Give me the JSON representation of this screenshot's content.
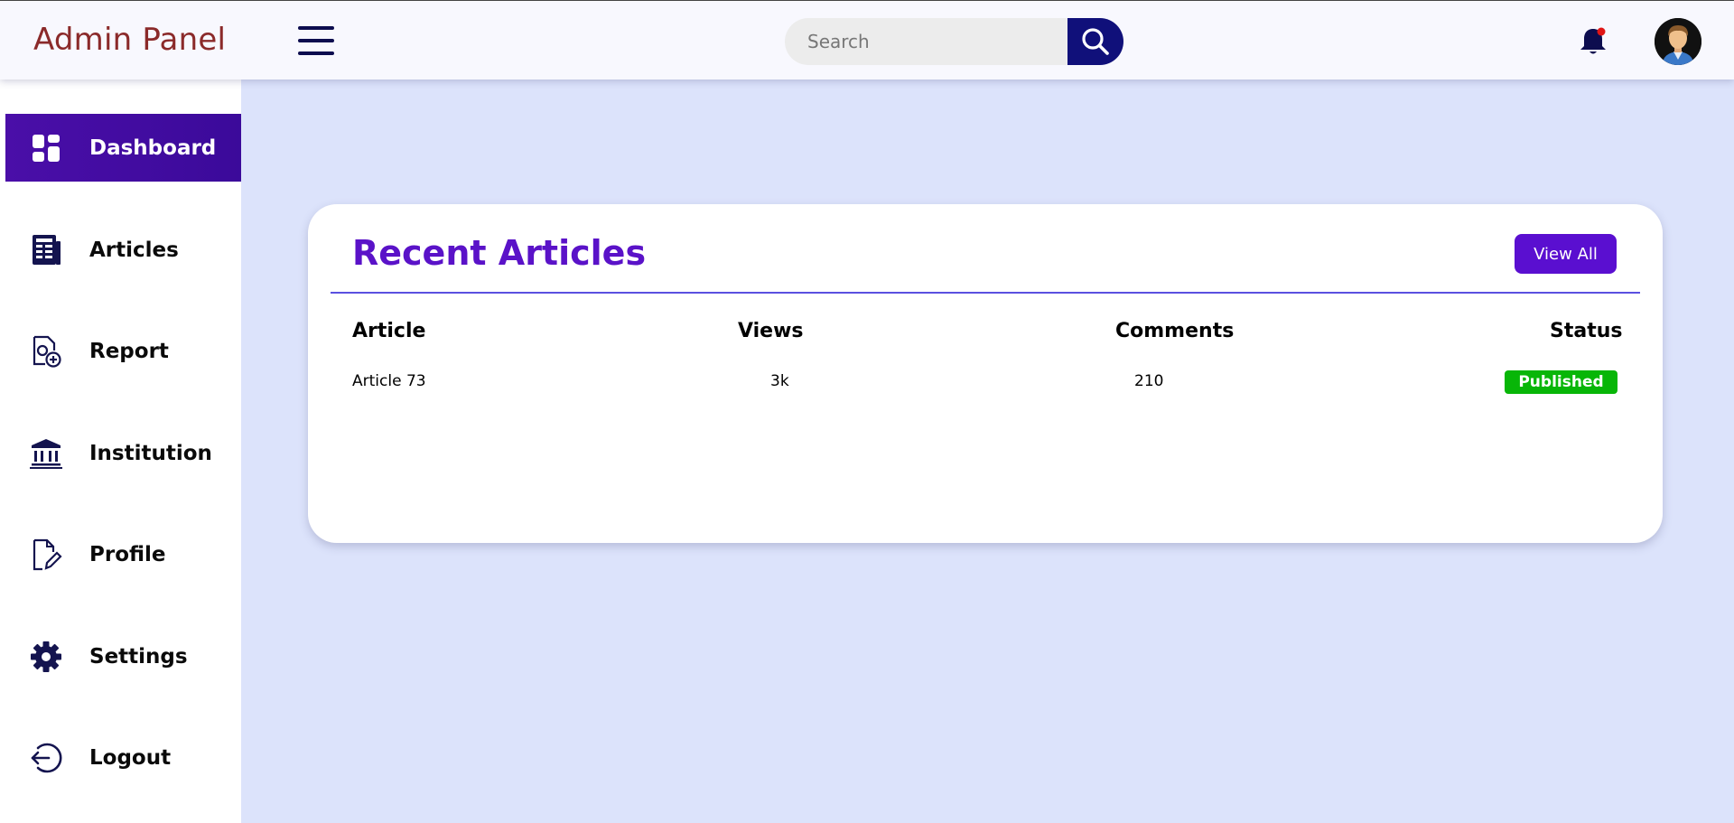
{
  "header": {
    "brand": "Admin Panel",
    "search_placeholder": "Search"
  },
  "sidebar": {
    "items": [
      {
        "label": "Dashboard",
        "icon": "dashboard-icon",
        "active": true
      },
      {
        "label": "Articles",
        "icon": "articles-icon"
      },
      {
        "label": "Report",
        "icon": "report-icon"
      },
      {
        "label": "Institution",
        "icon": "institution-icon"
      },
      {
        "label": "Profile",
        "icon": "profile-icon"
      },
      {
        "label": "Settings",
        "icon": "gear-icon"
      },
      {
        "label": "Logout",
        "icon": "logout-icon"
      }
    ]
  },
  "recent": {
    "title": "Recent Articles",
    "view_all": "View All",
    "columns": [
      "Article",
      "Views",
      "Comments",
      "Status"
    ],
    "rows": [
      {
        "article": "Article 73",
        "views": "3k",
        "comments": "210",
        "status": "Published"
      }
    ]
  },
  "colors": {
    "brand": "#8b2a2a",
    "accent": "#5a12c8",
    "sidebar_active": "#4a0ea8",
    "status_published": "#08b608",
    "background": "#dce3fb"
  }
}
